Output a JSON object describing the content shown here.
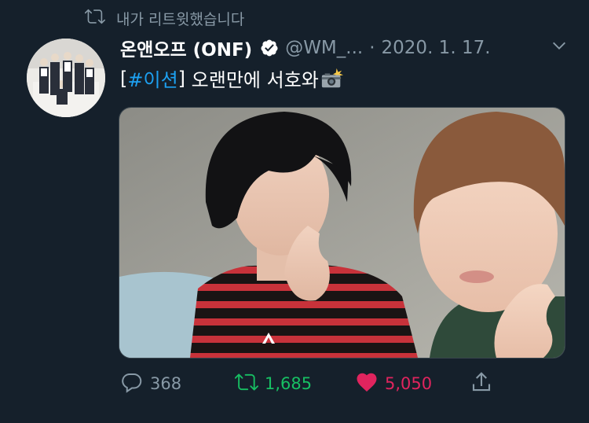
{
  "retweet_banner": {
    "text": "내가 리트윗했습니다",
    "icon": "retweet-icon"
  },
  "tweet": {
    "display_name": "온앤오프 (ONF)",
    "verified": true,
    "handle": "@WM_...",
    "separator": "·",
    "date": "2020. 1. 17.",
    "text_open_bracket": "[",
    "hashtag": "#이션",
    "text_close_bracket": "]",
    "text_body": " 오랜만에 서호와",
    "emoji": "camera-flash-icon"
  },
  "actions": {
    "reply_count": "368",
    "retweet_count": "1,685",
    "like_count": "5,050"
  },
  "colors": {
    "background": "#15202b",
    "muted": "#8899a6",
    "link": "#1da1f2",
    "retweet": "#17bf63",
    "like": "#e0245e"
  }
}
